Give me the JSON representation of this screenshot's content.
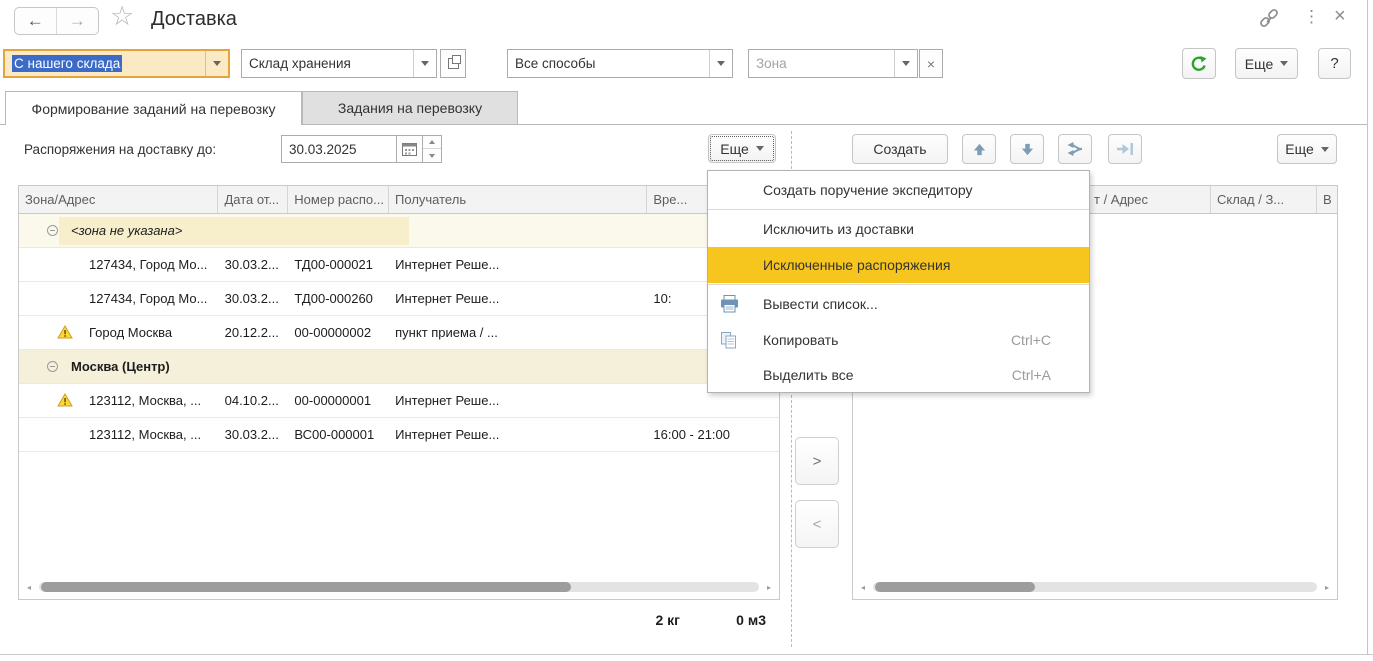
{
  "titlebar": {
    "title": "Доставка",
    "back": "←",
    "forward": "→"
  },
  "filters": {
    "delivery_type": {
      "value": "С нашего склада"
    },
    "warehouse": {
      "value": "Склад хранения"
    },
    "method": {
      "value": "Все способы"
    },
    "zone": {
      "placeholder": "Зона",
      "clear": "×"
    },
    "more_label": "Еще",
    "help_label": "?"
  },
  "tabs": [
    {
      "label": "Формирование заданий на перевозку"
    },
    {
      "label": "Задания на перевозку"
    }
  ],
  "left_panel": {
    "date_label": "Распоряжения на доставку до:",
    "date_value": "30.03.2025",
    "more_label": "Еще",
    "columns": [
      "Зона/Адрес",
      "Дата от...",
      "Номер распо...",
      "Получатель",
      "Вре..."
    ],
    "rows": [
      {
        "type": "group",
        "label": "<зона не указана>"
      },
      {
        "address": "127434, Город Мо...",
        "date": "30.03.2...",
        "number": "ТД00-000021",
        "recipient": "Интернет Реше...",
        "time": ""
      },
      {
        "address": "127434, Город Мо...",
        "date": "30.03.2...",
        "number": "ТД00-000260",
        "recipient": "Интернет Реше...",
        "time": "10:"
      },
      {
        "address": "Город Москва",
        "date": "20.12.2...",
        "number": "00-00000002",
        "recipient": "пункт приема / ...",
        "time": "",
        "warning": true
      },
      {
        "type": "group",
        "label": "Москва (Центр)"
      },
      {
        "address": "123112, Москва, ...",
        "date": "04.10.2...",
        "number": "00-00000001",
        "recipient": "Интернет Реше...",
        "time": "",
        "warning": true
      },
      {
        "address": "123112, Москва, ...",
        "date": "30.03.2...",
        "number": "ВС00-000001",
        "recipient": "Интернет Реше...",
        "time": "16:00 - 21:00"
      }
    ],
    "totals": {
      "weight": "2 кг",
      "volume": "0 м3"
    }
  },
  "context_menu": {
    "items": [
      {
        "label": "Создать поручение экспедитору"
      },
      {
        "label": "Исключить из доставки"
      },
      {
        "label": "Исключенные распоряжения"
      },
      {
        "label": "Вывести список..."
      },
      {
        "label": "Копировать",
        "shortcut": "Ctrl+C"
      },
      {
        "label": "Выделить все",
        "shortcut": "Ctrl+A"
      }
    ]
  },
  "right_panel": {
    "create_label": "Создать",
    "more_label": "Еще",
    "columns": [
      "т / Адрес",
      "Склад / З...",
      "В"
    ]
  },
  "transfer": {
    "right": ">",
    "left": "<"
  }
}
